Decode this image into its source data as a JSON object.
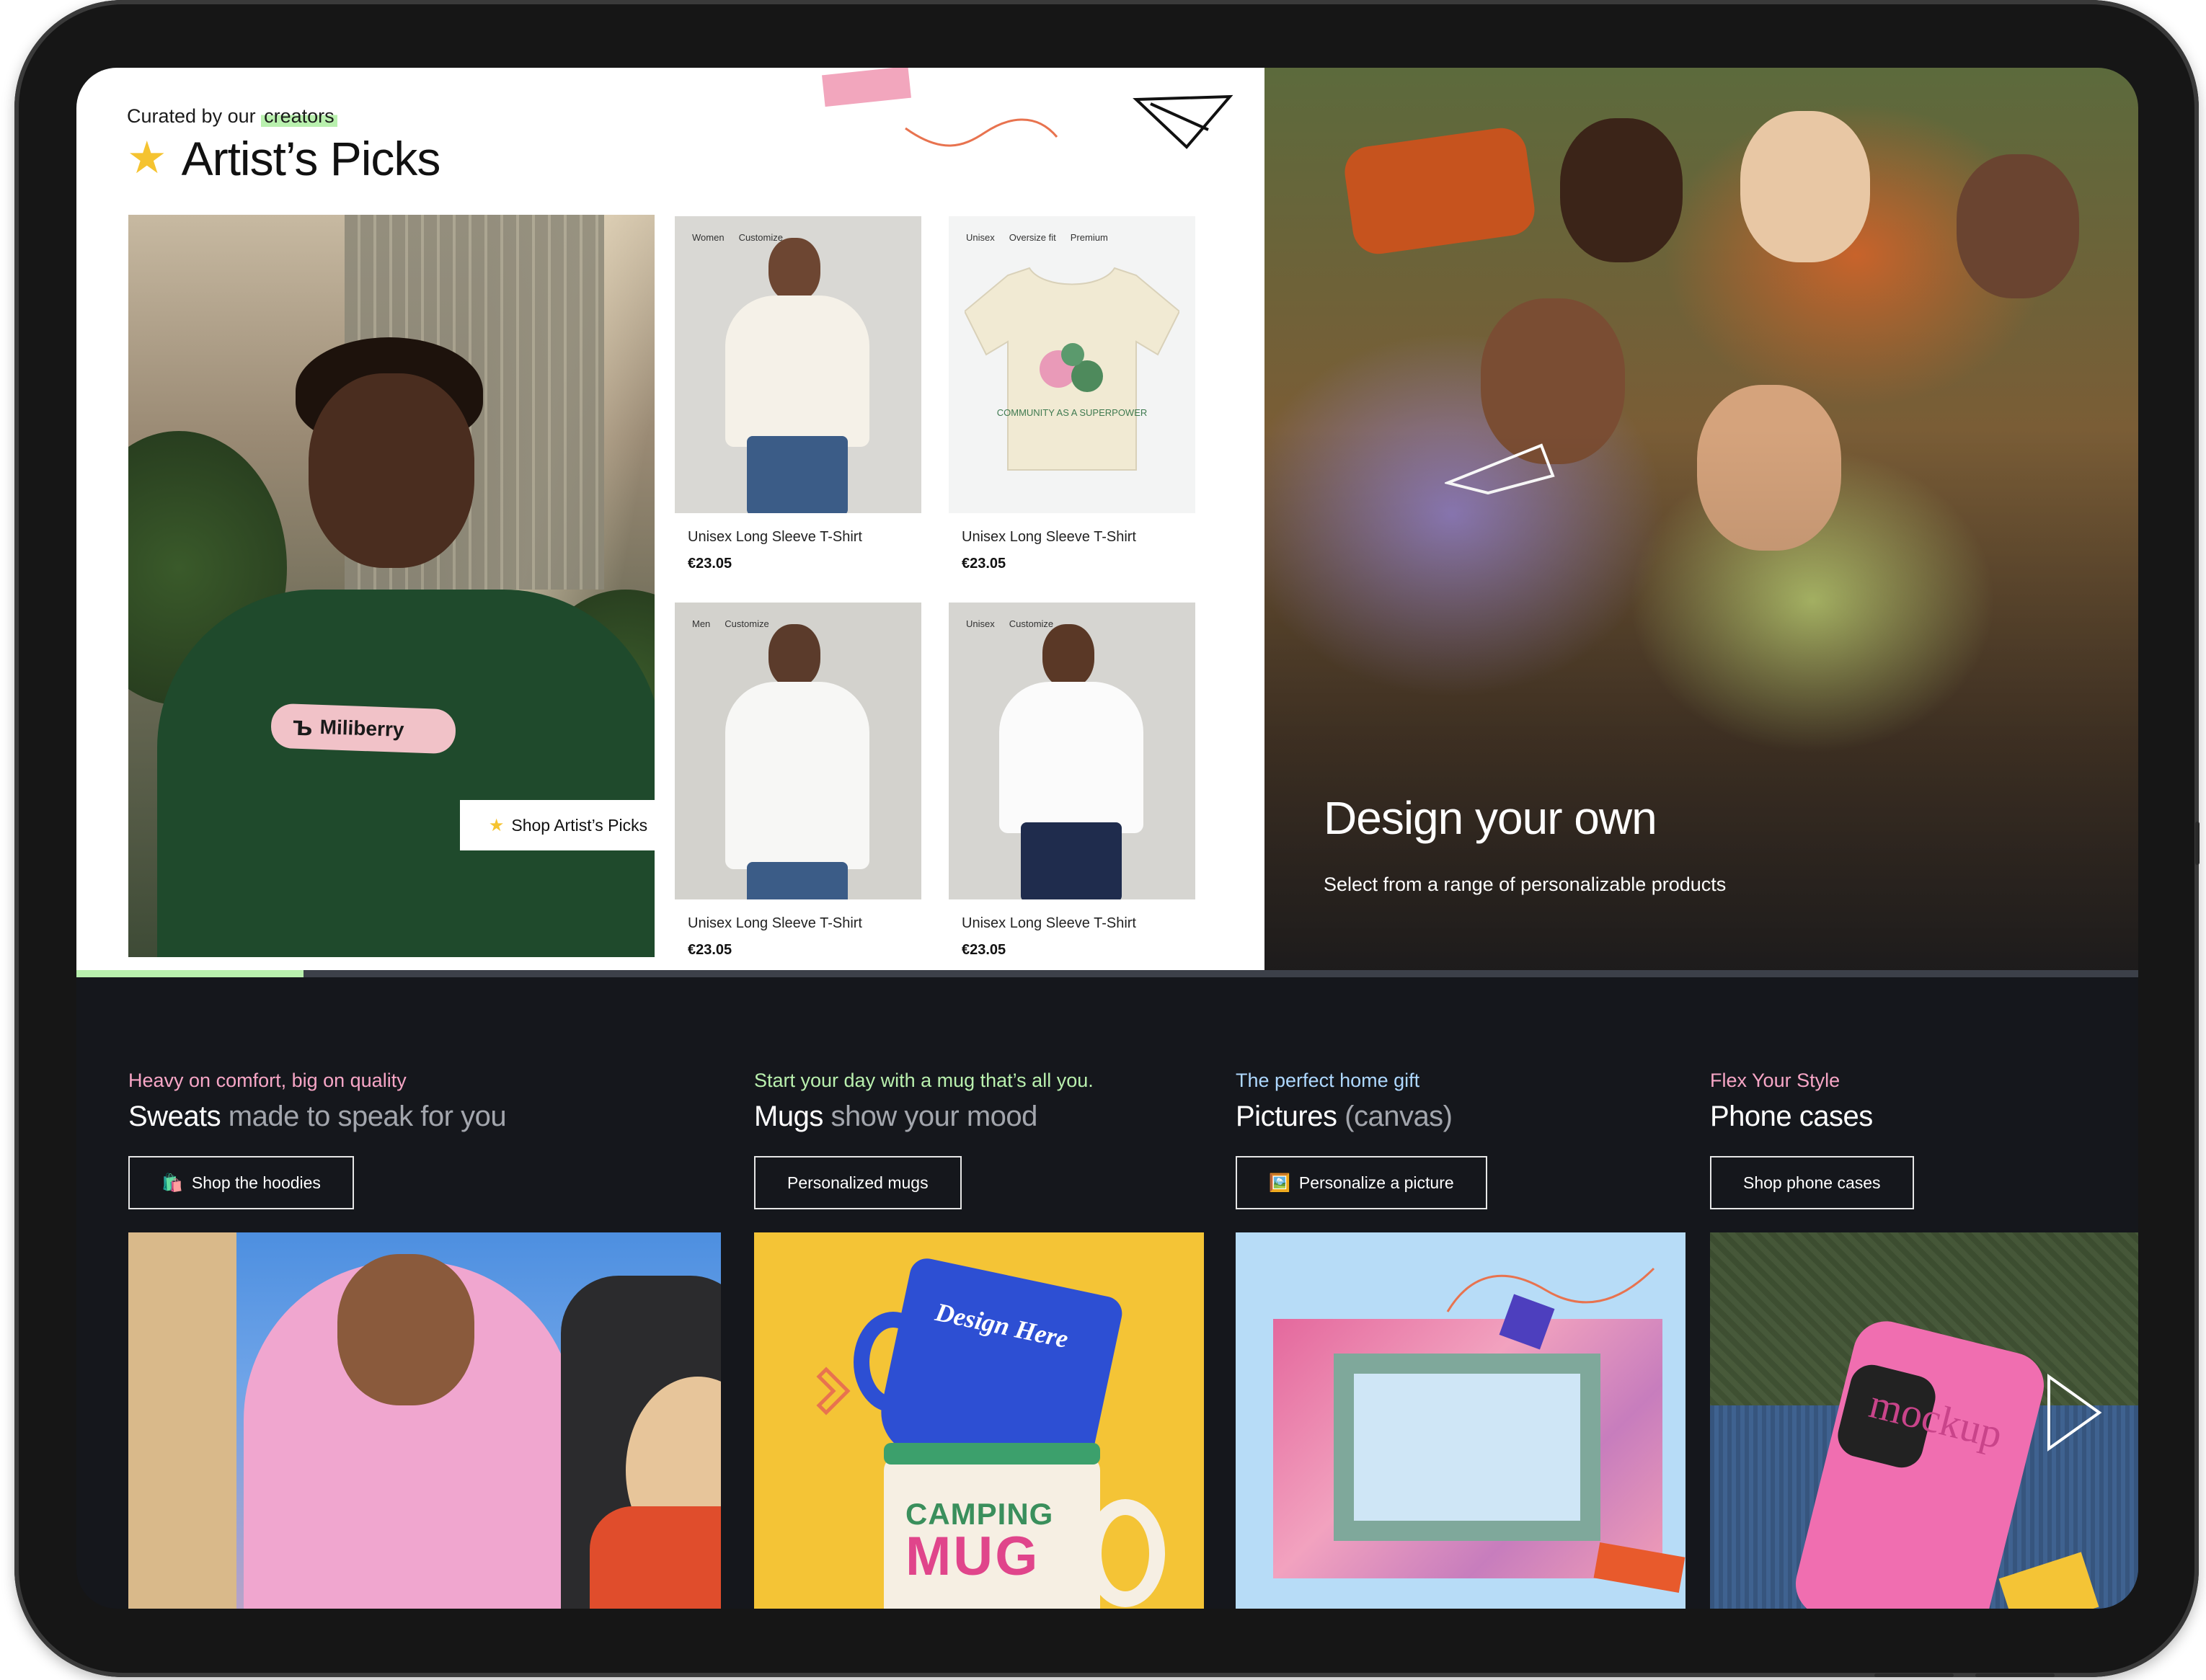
{
  "artists_picks": {
    "eyebrow_prefix": "Curated by our",
    "eyebrow_highlight": "creators",
    "title_icon": "star-icon",
    "title": "Artist’s Picks",
    "hero_brand": "Miliberry",
    "hero_cta": "Shop Artist’s Picks",
    "products": [
      {
        "tags": [
          "Women",
          "Customize"
        ],
        "name": "Unisex Long Sleeve T-Shirt",
        "price": "€23.05"
      },
      {
        "tags": [
          "Unisex",
          "Oversize fit",
          "Premium"
        ],
        "name": "Unisex Long Sleeve T-Shirt",
        "price": "€23.05",
        "print_text": "COMMUNITY AS A SUPERPOWER"
      },
      {
        "tags": [
          "Men",
          "Customize"
        ],
        "name": "Unisex Long Sleeve T-Shirt",
        "price": "€23.05"
      },
      {
        "tags": [
          "Unisex",
          "Customize"
        ],
        "name": "Unisex Long Sleeve T-Shirt",
        "price": "€23.05"
      }
    ]
  },
  "design_your_own": {
    "title": "Design your own",
    "subtitle": "Select from a range of personalizable products"
  },
  "slider": {
    "progress_fraction": 0.11
  },
  "categories": [
    {
      "kicker": "Heavy on comfort, big on quality",
      "kicker_color": "#f7a6c6",
      "headline_strong": "Sweats",
      "headline_muted": "made to speak for you",
      "cta_icon": "shopping-bag-icon",
      "cta_emoji": "🛍️",
      "cta": "Shop the hoodies"
    },
    {
      "kicker": "Start your day with a mug that’s all you.",
      "kicker_color": "#b9f0ae",
      "headline_strong": "Mugs",
      "headline_muted": "show your mood",
      "cta": "Personalized mugs",
      "mug_text_top": "Design Here",
      "mug_text_bottom_1": "CAMPING",
      "mug_text_bottom_2": "MUG"
    },
    {
      "kicker": "The perfect home gift",
      "kicker_color": "#aed8ff",
      "headline_strong": "Pictures",
      "headline_muted": "(canvas)",
      "cta_icon": "picture-icon",
      "cta_emoji": "🖼️",
      "cta": "Personalize a picture"
    },
    {
      "kicker": "Flex Your Style",
      "kicker_color": "#f7a6c6",
      "headline_strong": "Phone cases",
      "headline_muted": "",
      "cta": "Shop phone cases",
      "case_text": "mockup"
    }
  ],
  "colors": {
    "accent_green": "#b9f0ae",
    "dark_bg": "#15171c",
    "star": "#f5c330"
  }
}
